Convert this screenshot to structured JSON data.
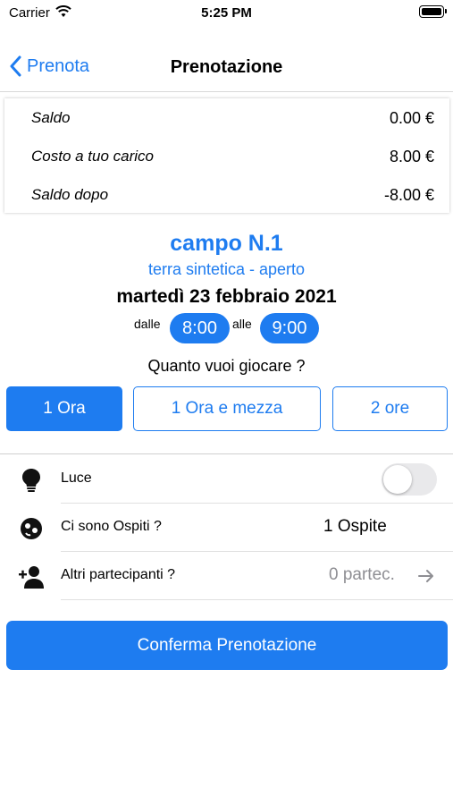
{
  "status_bar": {
    "carrier": "Carrier",
    "time": "5:25 PM"
  },
  "nav": {
    "back_label": "Prenota",
    "title": "Prenotazione"
  },
  "balance": [
    {
      "label": "Saldo",
      "value": "0.00 €"
    },
    {
      "label": "Costo a tuo carico",
      "value": "8.00 €"
    },
    {
      "label": "Saldo dopo",
      "value": "-8.00 €"
    }
  ],
  "court": {
    "name": "campo N.1",
    "type": "terra sintetica - aperto",
    "date": "martedì 23 febbraio 2021",
    "from_word": "dalle",
    "from_time": "8:00",
    "to_word": "alle",
    "to_time": "9:00"
  },
  "duration": {
    "question": "Quanto vuoi giocare ?",
    "options": [
      "1 Ora",
      "1 Ora e mezza",
      "2 ore"
    ],
    "selected_index": 0
  },
  "options": {
    "light": {
      "label": "Luce",
      "on": false,
      "icon": "lightbulb-icon"
    },
    "guests": {
      "label": "Ci sono Ospiti ?",
      "value": "1 Ospite",
      "icon": "guest-face-icon"
    },
    "participants": {
      "label": "Altri partecipanti ?",
      "value": "0 partec.",
      "icon": "add-person-icon"
    }
  },
  "confirm_label": "Conferma Prenotazione",
  "colors": {
    "accent": "#1e7cf0",
    "muted": "#8e8e93"
  }
}
